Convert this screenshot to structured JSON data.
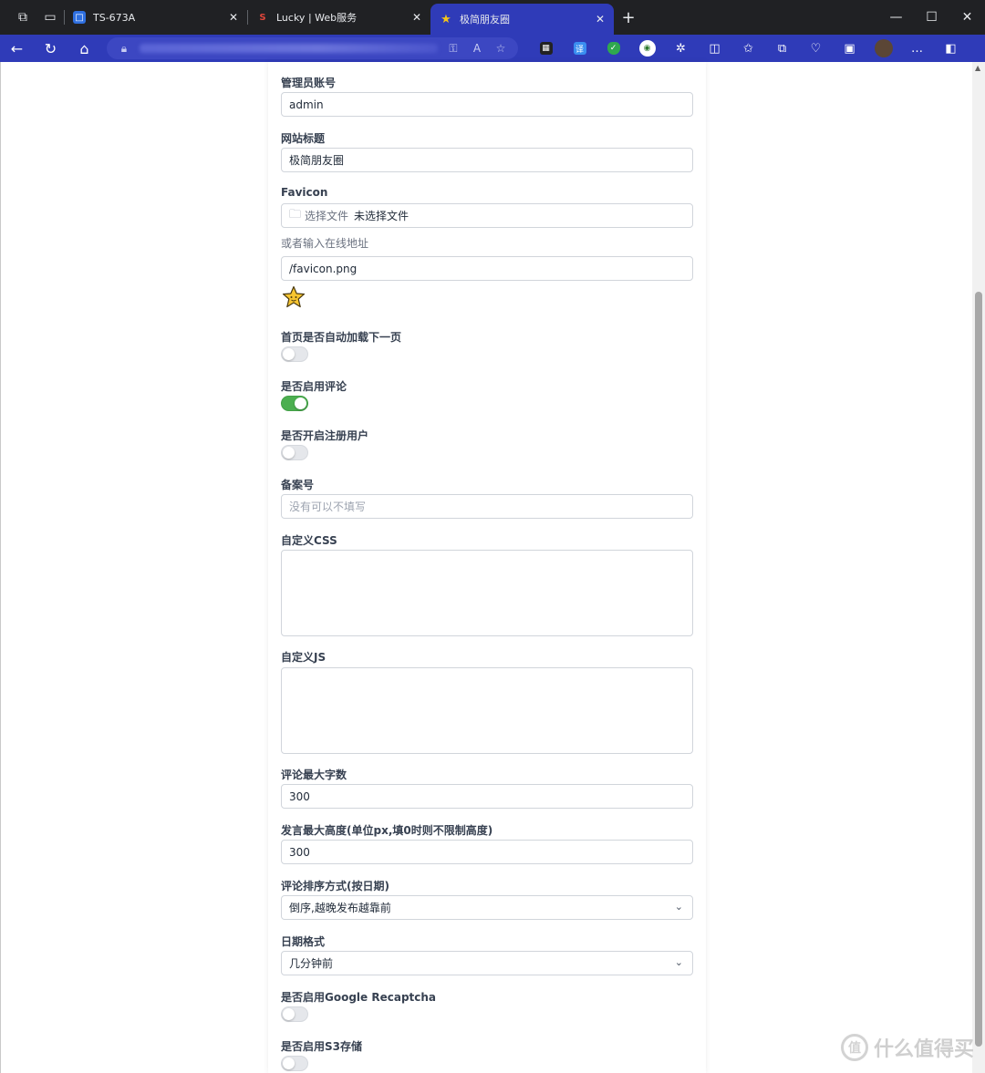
{
  "browser": {
    "tabs": [
      {
        "title": "TS-673A",
        "icon": "qnap-icon",
        "color": "#2e6fe0"
      },
      {
        "title": "Lucky | Web服务",
        "icon": "lucky-icon",
        "color": "#e0463b"
      },
      {
        "title": "极简朋友圈",
        "icon": "star-icon",
        "color": "#f5c518"
      }
    ],
    "new_tab": "+",
    "accent": "#2f3bb8"
  },
  "form": {
    "admin_account": {
      "label": "管理员账号",
      "value": "admin"
    },
    "site_title": {
      "label": "网站标题",
      "value": "极简朋友圈"
    },
    "favicon": {
      "label": "Favicon",
      "choose_file": "选择文件",
      "no_file": "未选择文件",
      "or_online": "或者输入在线地址",
      "url_value": "/favicon.png"
    },
    "auto_load_next": {
      "label": "首页是否自动加载下一页",
      "on": false
    },
    "enable_comments": {
      "label": "是否启用评论",
      "on": true
    },
    "enable_register": {
      "label": "是否开启注册用户",
      "on": false
    },
    "icp": {
      "label": "备案号",
      "placeholder": "没有可以不填写"
    },
    "custom_css": {
      "label": "自定义CSS"
    },
    "custom_js": {
      "label": "自定义JS"
    },
    "comment_max_len": {
      "label": "评论最大字数",
      "value": "300"
    },
    "post_max_height": {
      "label": "发言最大高度(单位px,填0时则不限制高度)",
      "value": "300"
    },
    "comment_sort": {
      "label": "评论排序方式(按日期)",
      "value": "倒序,越晚发布越靠前"
    },
    "date_format": {
      "label": "日期格式",
      "value": "几分钟前"
    },
    "google_recaptcha": {
      "label": "是否启用Google Recaptcha",
      "on": false
    },
    "s3_storage": {
      "label": "是否启用S3存储",
      "on": false
    },
    "toggle_on_color": "#4caf50"
  },
  "watermark": {
    "text": "什么值得买",
    "badge": "值"
  }
}
